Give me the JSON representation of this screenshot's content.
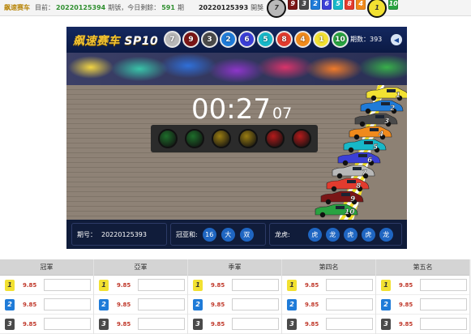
{
  "topbar": {
    "brand": "飙速赛车",
    "current_label": "目前：",
    "current_period": "20220125394",
    "period_suffix": "期號，今日剩餘：",
    "remaining": "591",
    "remaining_suffix": "期",
    "last_period": "20220125393",
    "last_suffix": "開獎",
    "results": [
      "7",
      "9",
      "3",
      "2",
      "6",
      "5",
      "8",
      "4",
      "1",
      "10"
    ]
  },
  "ball_colors": {
    "1": "#f2e132",
    "2": "#1f7bd8",
    "3": "#4a4a4a",
    "4": "#f08a1c",
    "5": "#17b8c8",
    "6": "#3b3fd6",
    "7": "#b8b8b8",
    "8": "#e23b2e",
    "9": "#7a1616",
    "10": "#29a341"
  },
  "game": {
    "title_cn": "飙速赛车",
    "title_en": "SP10",
    "draw_balls": [
      "7",
      "9",
      "3",
      "2",
      "6",
      "5",
      "8",
      "4",
      "1",
      "10"
    ],
    "period_label": "期数：393",
    "timer": "00:27",
    "timer_ms": "07",
    "light_colors": [
      "#1e6e2b",
      "#1e6e2b",
      "#9a7d12",
      "#9a7d12",
      "#b51b1b",
      "#b51b1b"
    ],
    "cars": [
      "1",
      "2",
      "3",
      "4",
      "5",
      "6",
      "7",
      "8",
      "9",
      "10"
    ]
  },
  "info": {
    "period_label": "期号：",
    "period_value": "20220125393",
    "sum_label": "冠亚和:",
    "sum_value": "16",
    "sum_size": "大",
    "sum_parity": "双",
    "dragon_label": "龙虎:",
    "dragon_values": [
      "虎",
      "龙",
      "虎",
      "虎",
      "龙"
    ]
  },
  "table": {
    "columns": [
      {
        "title": "冠軍",
        "odds": [
          "9.85",
          "9.85",
          "9.85"
        ]
      },
      {
        "title": "亞軍",
        "odds": [
          "9.85",
          "9.85",
          "9.85"
        ]
      },
      {
        "title": "季軍",
        "odds": [
          "9.85",
          "9.85",
          "9.85"
        ]
      },
      {
        "title": "第四名",
        "odds": [
          "9.85",
          "9.85",
          "9.85"
        ]
      },
      {
        "title": "第五名",
        "odds": [
          "9.85",
          "9.85",
          "9.85"
        ]
      }
    ],
    "row_numbers": [
      "1",
      "2",
      "3"
    ]
  }
}
